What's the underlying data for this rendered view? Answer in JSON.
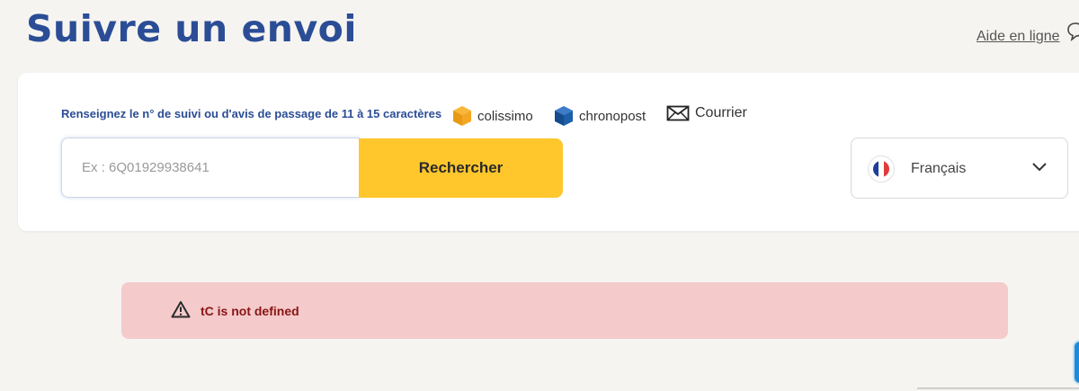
{
  "header": {
    "title": "Suivre un envoi",
    "help_link": "Aide en ligne"
  },
  "search": {
    "instruction": "Renseignez le n° de suivi ou d'avis de passage de 11 à 15 caractères",
    "carriers": [
      {
        "label": "colissimo",
        "icon": "colissimo-box-icon",
        "color": "#f5a623"
      },
      {
        "label": "chronopost",
        "icon": "chronopost-box-icon",
        "color": "#1d5fa8"
      },
      {
        "label": "Courrier",
        "icon": "envelope-icon"
      }
    ],
    "input_placeholder": "Ex : 6Q01929938641",
    "input_value": "",
    "button_label": "Rechercher"
  },
  "language": {
    "selected": "Français",
    "flag_icon": "france-flag-icon"
  },
  "error": {
    "message": "tC is not defined",
    "icon": "warning-icon"
  },
  "colors": {
    "brand_blue": "#2b4d96",
    "button_yellow": "#ffc72c",
    "error_bg": "#f4cacb",
    "error_text": "#8a1414"
  }
}
